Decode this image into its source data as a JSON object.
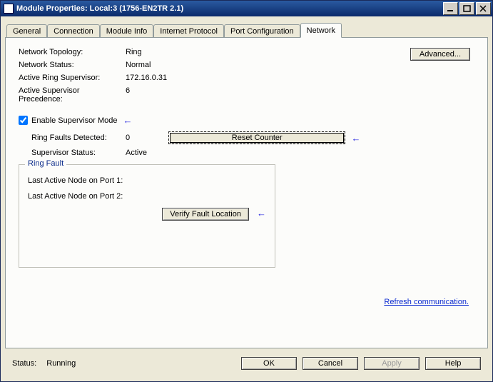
{
  "window": {
    "title": "Module Properties: Local:3 (1756-EN2TR 2.1)"
  },
  "tabs": {
    "general": "General",
    "connection": "Connection",
    "moduleinfo": "Module Info",
    "internetprotocol": "Internet Protocol",
    "portconfig": "Port Configuration",
    "network": "Network"
  },
  "network": {
    "labels": {
      "topology": "Network Topology:",
      "status": "Network Status:",
      "active_supervisor": "Active Ring Supervisor:",
      "supervisor_precedence": "Active Supervisor Precedence:"
    },
    "values": {
      "topology": "Ring",
      "status": "Normal",
      "active_supervisor": "172.16.0.31",
      "supervisor_precedence": "6"
    },
    "advanced_btn": "Advanced...",
    "enable_supervisor_label": "Enable Supervisor Mode",
    "enable_supervisor_checked": true,
    "sub": {
      "faults_label": "Ring Faults Detected:",
      "faults_value": "0",
      "reset_counter_btn": "Reset Counter",
      "supervisor_status_label": "Supervisor Status:",
      "supervisor_status_value": "Active"
    },
    "ring_fault": {
      "legend": "Ring Fault",
      "port1": "Last Active Node on Port 1:",
      "port2": "Last Active Node on Port 2:",
      "verify_btn": "Verify Fault Location"
    },
    "refresh_link": "Refresh communication."
  },
  "footer": {
    "status_label": "Status:",
    "status_value": "Running",
    "ok": "OK",
    "cancel": "Cancel",
    "apply": "Apply",
    "help": "Help"
  }
}
